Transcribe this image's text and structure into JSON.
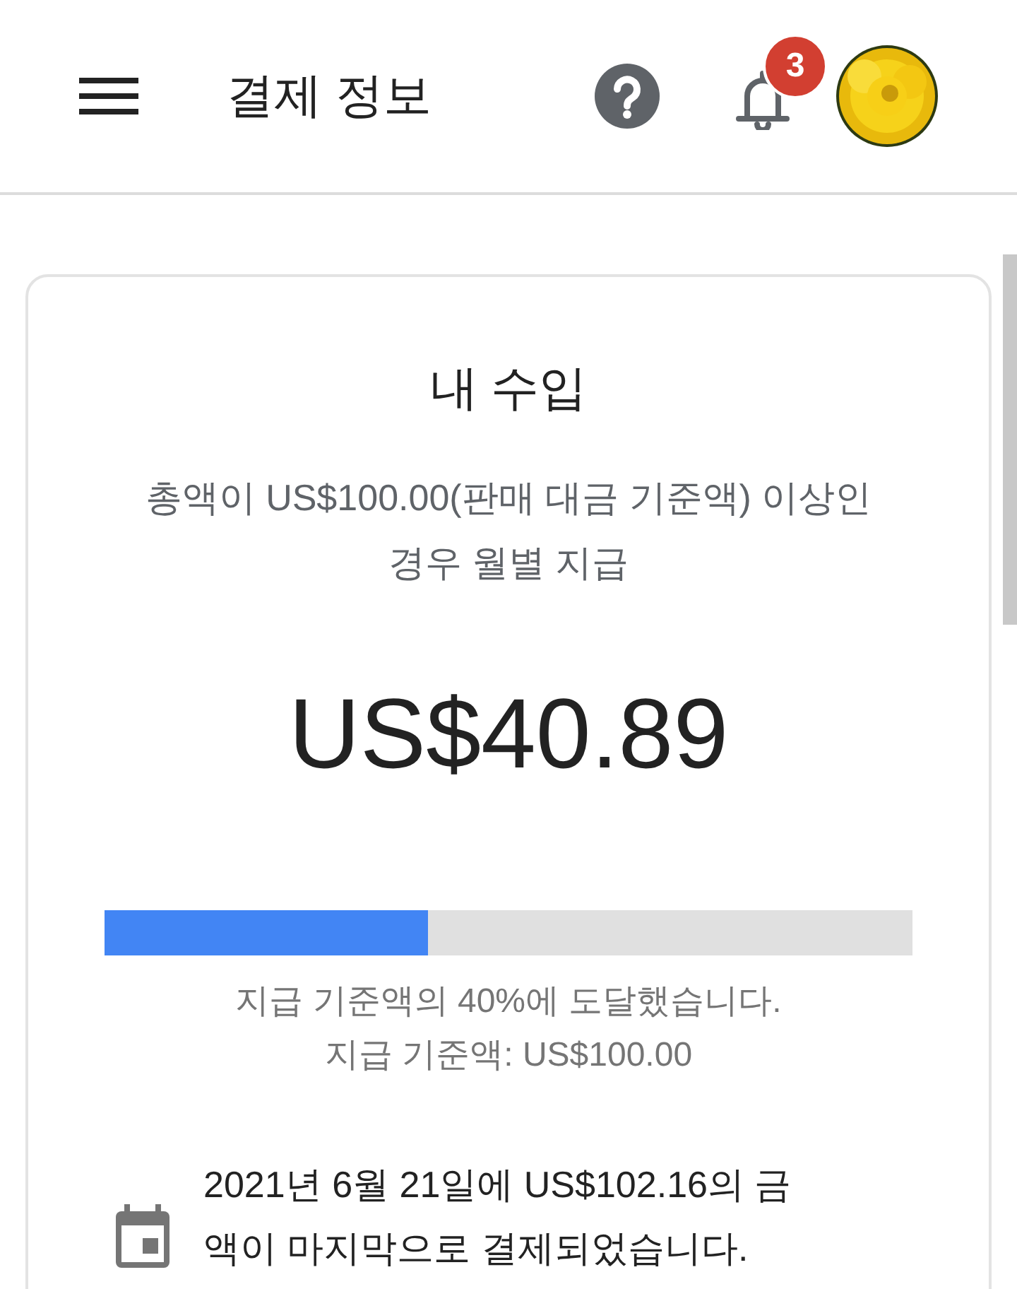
{
  "header": {
    "title": "결제 정보",
    "notifications": {
      "count": "3"
    }
  },
  "earnings_card": {
    "title": "내 수입",
    "description": "총액이 US$100.00(판매 대금 기준액) 이상인 경우 월별 지급",
    "amount": "US$40.89",
    "progress": {
      "level": 0.4,
      "caption": "지급 기준액의 40%에 도달했습니다.",
      "threshold": "지급 기준액: US$100.00"
    },
    "last_payment": "2021년 6월 21일에 US$102.16의 금액이 마지막으로 결제되었습니다."
  }
}
